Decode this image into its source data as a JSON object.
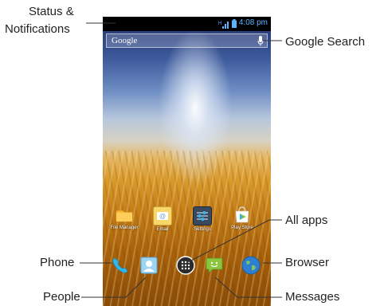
{
  "callouts": {
    "status_notifications_line1": "Status &",
    "status_notifications_line2": "Notifications",
    "google_search": "Google Search",
    "all_apps": "All apps",
    "phone": "Phone",
    "browser": "Browser",
    "people": "People",
    "messages": "Messages"
  },
  "status_bar": {
    "time": "4:08 pm",
    "network": "H"
  },
  "search_bar": {
    "label": "Google",
    "mic_icon": "mic-icon"
  },
  "home_apps": [
    {
      "label": "File Manager",
      "icon": "folder-icon"
    },
    {
      "label": "Email",
      "icon": "email-icon"
    },
    {
      "label": "Settings",
      "icon": "settings-icon"
    },
    {
      "label": "Play Store",
      "icon": "play-store-icon"
    }
  ],
  "dock": [
    {
      "name": "Phone",
      "icon": "phone-icon"
    },
    {
      "name": "People",
      "icon": "people-icon"
    },
    {
      "name": "All apps",
      "icon": "all-apps-icon"
    },
    {
      "name": "Messages",
      "icon": "messages-icon"
    },
    {
      "name": "Browser",
      "icon": "browser-icon"
    }
  ],
  "colors": {
    "status_time": "#59b3ff",
    "callout_text": "#222222",
    "callout_line": "#333333"
  }
}
